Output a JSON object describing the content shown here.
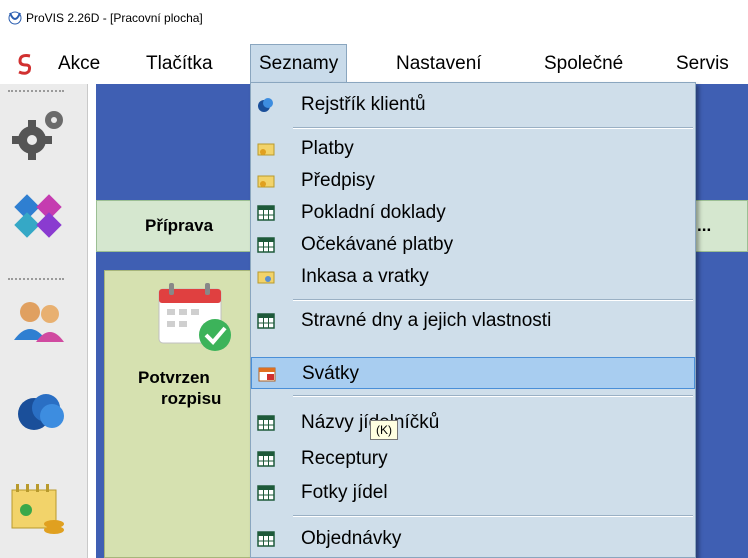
{
  "window": {
    "title": "ProVIS 2.26D - [Pracovní plocha]"
  },
  "menubar": {
    "items": [
      "Akce",
      "Tlačítka",
      "Seznamy",
      "Nastavení",
      "Společné",
      "Servis"
    ],
    "active": "Seznamy"
  },
  "desktop": {
    "band_label": "Přípravа",
    "band_more": "...",
    "tile_line1": "Potvrzen",
    "tile_line2": "rozpisu"
  },
  "seznamy_menu": {
    "items": [
      {
        "label": "Rejstřík klientů",
        "icon": "clients-icon"
      },
      {
        "label": "Platby",
        "icon": "payments-icon"
      },
      {
        "label": "Předpisy",
        "icon": "prescriptions-icon"
      },
      {
        "label": "Pokladní doklady",
        "icon": "table-icon"
      },
      {
        "label": "Očekávané platby",
        "icon": "table-icon"
      },
      {
        "label": "Inkasa a vratky",
        "icon": "collections-icon"
      },
      {
        "label": "Stravné dny a jejich vlastnosti",
        "icon": "table-icon"
      },
      {
        "label": "Svátky",
        "icon": "calendar-icon",
        "highlighted": true
      },
      {
        "label": "Názvy jídelníčků",
        "icon": "table-icon"
      },
      {
        "label": "Receptury",
        "icon": "table-icon"
      },
      {
        "label": "Fotky jídel",
        "icon": "table-icon"
      },
      {
        "label": "Objednávky",
        "icon": "table-icon"
      }
    ]
  },
  "tooltip": {
    "text": "(K)"
  },
  "colors": {
    "desktop": "#3f5fb3",
    "menu_bg": "#cfdeea",
    "highlight": "#a8cdf0"
  }
}
